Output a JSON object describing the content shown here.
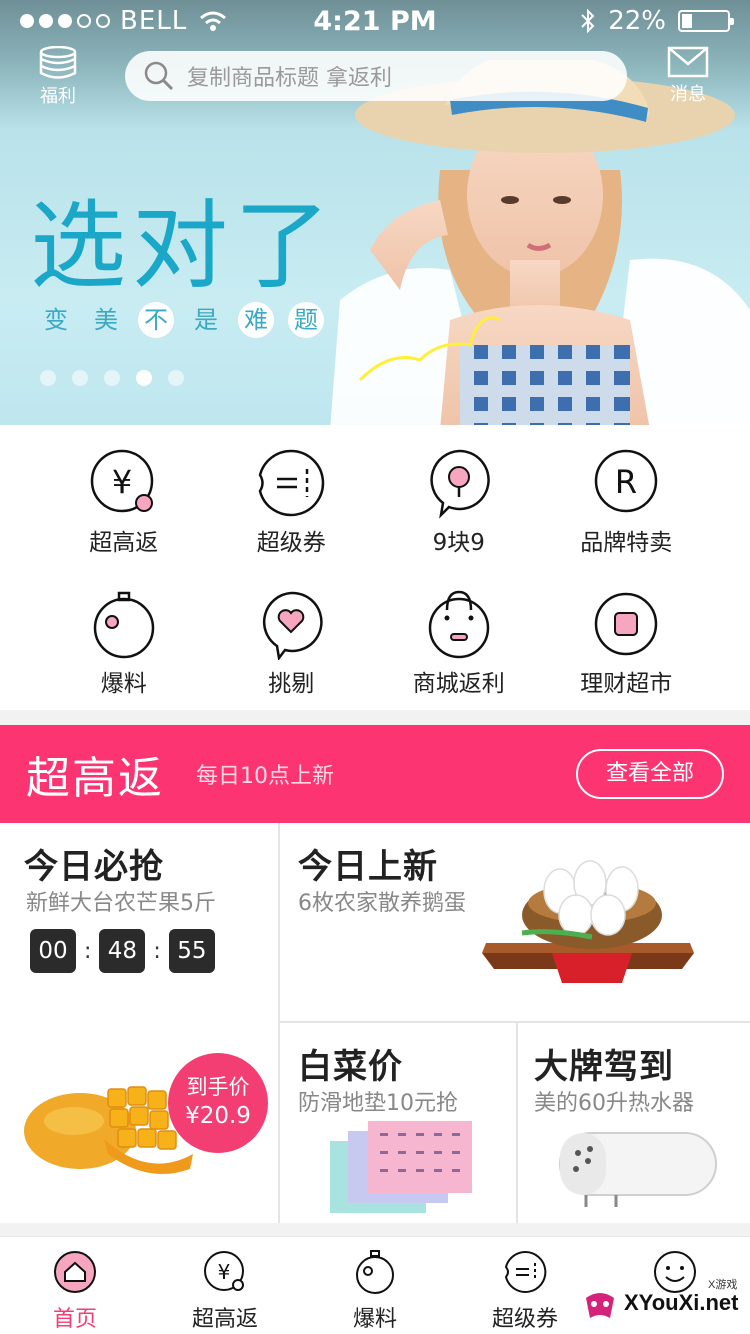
{
  "status_bar": {
    "carrier": "BELL",
    "time": "4:21 PM",
    "battery": "22%",
    "battery_level": 0.22,
    "signal_bars_filled": 3,
    "signal_bars_total": 5
  },
  "topbar": {
    "left_label": "福利",
    "search_placeholder": "复制商品标题 拿返利",
    "right_label": "消息"
  },
  "banner": {
    "headline": "选对了",
    "sub_chars": [
      "变",
      "美",
      "不",
      "是",
      "难",
      "题"
    ],
    "highlighted_chars": [
      2,
      4,
      5
    ],
    "script_text": "Let's go!",
    "dots_total": 5,
    "dots_active": 3
  },
  "grid": [
    {
      "label": "超高返",
      "icon": "yen-icon"
    },
    {
      "label": "超级券",
      "icon": "coupon-icon"
    },
    {
      "label": "9块9",
      "icon": "pin-icon"
    },
    {
      "label": "品牌特卖",
      "icon": "brand-r-icon"
    },
    {
      "label": "爆料",
      "icon": "bomb-icon"
    },
    {
      "label": "挑剔",
      "icon": "heart-bubble-icon"
    },
    {
      "label": "商城返利",
      "icon": "shopping-bag-icon"
    },
    {
      "label": "理财超市",
      "icon": "square-circle-icon"
    }
  ],
  "promo": {
    "title": "超高返",
    "subtitle": "每日10点上新",
    "view_all": "查看全部"
  },
  "cards": {
    "a": {
      "title": "今日必抢",
      "subtitle": "新鲜大台农芒果5斤",
      "countdown": [
        "00",
        "48",
        "55"
      ],
      "price_label": "到手价",
      "price": "¥20.9"
    },
    "b": {
      "title": "今日上新",
      "subtitle": "6枚农家散养鹅蛋"
    },
    "c": {
      "title": "白菜价",
      "subtitle": "防滑地垫10元抢"
    },
    "d": {
      "title": "大牌驾到",
      "subtitle": "美的60升热水器"
    }
  },
  "tabbar": [
    {
      "label": "首页",
      "active": true
    },
    {
      "label": "超高返",
      "active": false
    },
    {
      "label": "爆料",
      "active": false
    },
    {
      "label": "超级券",
      "active": false
    },
    {
      "label": "",
      "active": false
    }
  ],
  "watermark": {
    "text": "XYouXi.net",
    "small": "X游戏"
  },
  "colors": {
    "accent": "#f33e73",
    "promo_bg": "#fc3572",
    "banner_text": "#1ba8c8"
  }
}
